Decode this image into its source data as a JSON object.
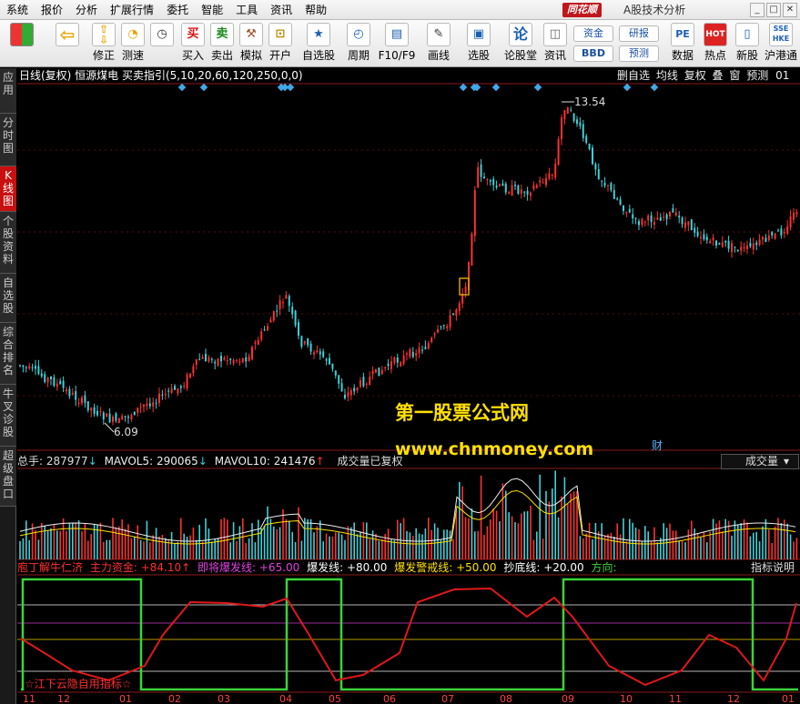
{
  "menu": {
    "items": [
      "系统",
      "报价",
      "分析",
      "扩展行情",
      "委托",
      "智能",
      "工具",
      "资讯",
      "帮助"
    ],
    "brand": "同花顺",
    "app_title": "A股技术分析"
  },
  "toolbar": {
    "buttons": [
      {
        "label": "",
        "icon": "windows-logo-icon"
      },
      {
        "label": "",
        "icon": "back-arrow-icon"
      },
      {
        "label": "修正",
        "icon": "up-down-arrow-icon"
      },
      {
        "label": "测速",
        "icon": "clock-icon"
      },
      {
        "label": "买入",
        "icon": "buy-icon",
        "glyph": "买"
      },
      {
        "label": "卖出",
        "icon": "sell-icon",
        "glyph": "卖"
      },
      {
        "label": "模拟",
        "icon": "hammer-icon"
      },
      {
        "label": "开户",
        "icon": "lock-icon"
      },
      {
        "label": "自选股",
        "icon": "star-icon"
      },
      {
        "label": "周期",
        "icon": "cycle-icon"
      },
      {
        "label": "F10/F9",
        "icon": "f10-icon"
      },
      {
        "label": "画线",
        "icon": "pen-icon"
      },
      {
        "label": "选股",
        "icon": "select-stock-icon"
      },
      {
        "label": "论股堂",
        "icon": "forum-icon",
        "glyph": "论"
      },
      {
        "label": "资讯",
        "icon": "info-icon"
      },
      {
        "label": "数据",
        "icon": "pe-icon",
        "glyph": "PE"
      },
      {
        "label": "热点",
        "icon": "hot-icon"
      },
      {
        "label": "新股",
        "icon": "ipo-icon"
      },
      {
        "label": "沪港通",
        "icon": "sse-hke-icon"
      }
    ],
    "small_buttons": [
      "资金",
      "BBD",
      "研报",
      "预测"
    ]
  },
  "left_tabs": [
    "应用",
    "分时图",
    "K线图",
    "个股资料",
    "自选股",
    "综合排名",
    "牛叉诊股",
    "超级盘口"
  ],
  "chart_header": {
    "title": "日线(复权)  恒源煤电  买卖指引(5,10,20,60,120,250,0,0)",
    "tabs": [
      "删自选",
      "均线",
      "复权",
      "叠",
      "窗",
      "预测",
      "01"
    ],
    "high_label": "13.54",
    "low_label": "6.09",
    "marker": "财",
    "watermark_1": "第一股票公式网",
    "watermark_2": "www.chnmoney.com"
  },
  "volume": {
    "total_label": "总手: 287977",
    "mavol5": "MAVOL5: 290065",
    "mavol10": "MAVOL10: 241476",
    "note": "成交量已复权",
    "dropdown": "成交量"
  },
  "indicator": {
    "name": "庖丁解牛仁济",
    "main_fund": "主力资金: +84.10",
    "about_to_burst": "即将爆发线: +65.00",
    "burst": "爆发线: +80.00",
    "warning": "爆发警戒线: +50.00",
    "bottom": "抄底线: +20.00",
    "direction": "方向:",
    "help": "指标说明",
    "signature": "☆江下云隐自用指标☆"
  },
  "xaxis": {
    "labels": [
      "11",
      "12",
      "01",
      "02",
      "03",
      "04",
      "05",
      "06",
      "07",
      "08",
      "09",
      "10",
      "11",
      "12",
      "01"
    ]
  },
  "colors": {
    "up": "#ff3030",
    "down": "#3fd0d8",
    "ma": "#ffffff",
    "green_line": "#3ad43a",
    "main_fund": "#e01818"
  }
}
